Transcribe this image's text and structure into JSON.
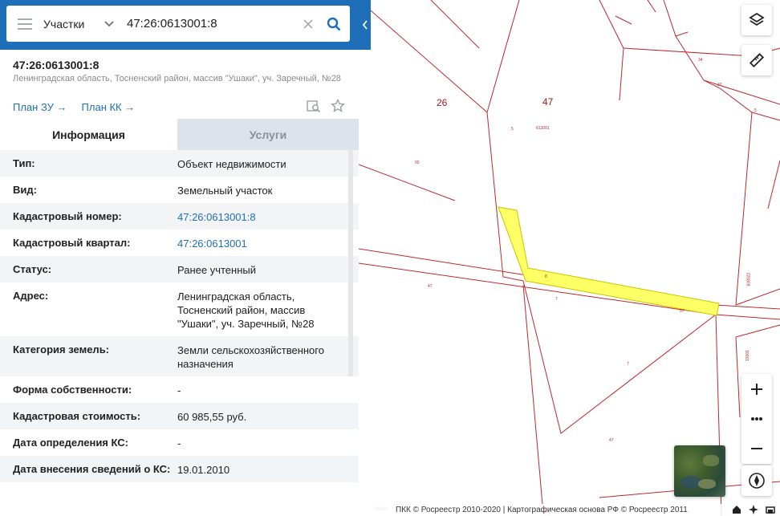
{
  "search": {
    "type_label": "Участки",
    "value": "47:26:0613001:8"
  },
  "object": {
    "title": "47:26:0613001:8",
    "address": "Ленинградская область, Тосненский район, массив \"Ушаки\", уч. Заречный, №28"
  },
  "links": {
    "plan_zu": "План ЗУ →",
    "plan_kk": "План КК →"
  },
  "tabs": {
    "info": "Информация",
    "services": "Услуги"
  },
  "info": [
    {
      "key": "Тип:",
      "value": "Объект недвижимости"
    },
    {
      "key": "Вид:",
      "value": "Земельный участок"
    },
    {
      "key": "Кадастровый номер:",
      "value": "47:26:0613001:8"
    },
    {
      "key": "Кадастровый квартал:",
      "value": "47:26:0613001"
    },
    {
      "key": "Статус:",
      "value": "Ранее учтенный"
    },
    {
      "key": "Адрес:",
      "value": "Ленинградская область, Тосненский район, массив \"Ушаки\", уч. Заречный, №28"
    },
    {
      "key": "Категория земель:",
      "value": "Земли сельскохозяйственного назначения"
    },
    {
      "key": "Форма собственности:",
      "value": "-"
    },
    {
      "key": "Кадастровая стоимость:",
      "value": "60 985,55 руб."
    },
    {
      "key": "Дата определения КС:",
      "value": "-"
    },
    {
      "key": "Дата внесения сведений о КС:",
      "value": "19.01.2010"
    }
  ],
  "map": {
    "labels": {
      "l26": "26",
      "l47": "47",
      "q613001": "613001",
      "l5a": "5",
      "l90": "90",
      "l47b": "47",
      "l7a": "7",
      "l7b": "7",
      "l47c": "47",
      "l34": "34",
      "l32": "32",
      "l5b": "5",
      "l8": "8",
      "l57": "57",
      "q608022": "608022",
      "q19": "19001",
      "q613bottom": "613001",
      "l47d": "47"
    },
    "attribution": "ПКК © Росреестр 2010-2020 | Картографическая основа РФ © Росреестр 2011"
  },
  "colors": {
    "brand": "#1f6fb8",
    "parcel_line": "#c0282c",
    "highlight": "#ffff66"
  }
}
